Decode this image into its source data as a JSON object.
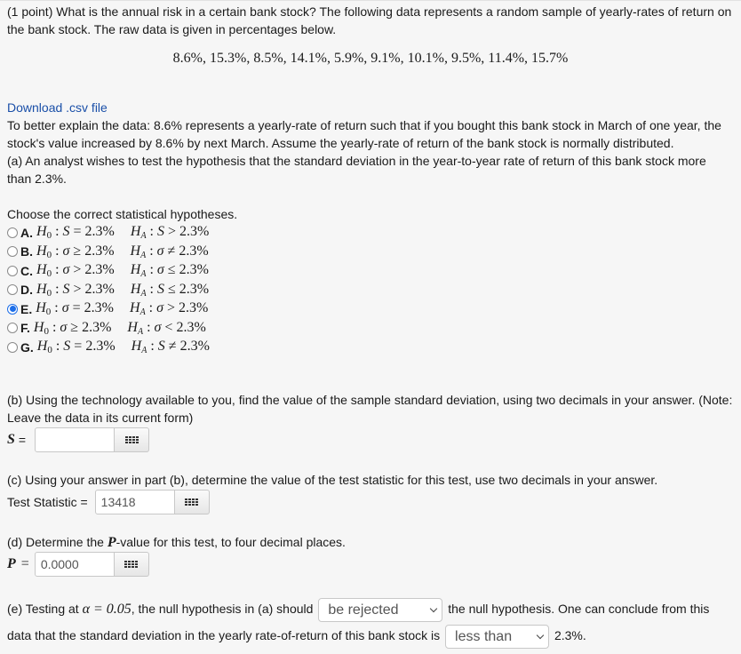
{
  "question": {
    "intro_line1": "(1 point) What is the annual risk in a certain bank stock? The following data represents a random sample of yearly-rates of return on",
    "intro_line2": "the bank stock. The raw data is given in percentages below.",
    "data_values": "8.6%, 15.3%, 8.5%, 14.1%, 5.9%, 9.1%, 10.1%, 9.5%, 11.4%, 15.7%",
    "download_link": "Download .csv file",
    "explain_line1": "To better explain the data: 8.6% represents a yearly-rate of return such that if you bought this bank stock in March of one year, the",
    "explain_line2": "stock's value increased by 8.6% by next March. Assume the yearly-rate of return of the bank stock is normally distributed.",
    "part_a_line1": "(a) An analyst wishes to test the hypothesis that the standard deviation in the year-to-year rate of return of this bank stock more",
    "part_a_line2": "than 2.3%."
  },
  "hypotheses": {
    "prompt": "Choose the correct statistical hypotheses.",
    "selected": "E",
    "options": [
      {
        "letter": "A.",
        "h0": "H₀ : S = 2.3%",
        "ha": "Hₐ : S > 2.3%",
        "checked": false
      },
      {
        "letter": "B.",
        "h0": "H₀ : σ ≥ 2.3%",
        "ha": "Hₐ : σ ≠ 2.3%",
        "checked": false
      },
      {
        "letter": "C.",
        "h0": "H₀ : σ > 2.3%",
        "ha": "Hₐ : σ ≤ 2.3%",
        "checked": false
      },
      {
        "letter": "D.",
        "h0": "H₀ : S > 2.3%",
        "ha": "Hₐ : S ≤ 2.3%",
        "checked": false
      },
      {
        "letter": "E.",
        "h0": "H₀ : σ = 2.3%",
        "ha": "Hₐ : σ > 2.3%",
        "checked": true
      },
      {
        "letter": "F.",
        "h0": "H₀ : σ ≥ 2.3%",
        "ha": "Hₐ : σ < 2.3%",
        "checked": false
      },
      {
        "letter": "G.",
        "h0": "H₀ : S = 2.3%",
        "ha": "Hₐ : S ≠ 2.3%",
        "checked": false
      }
    ]
  },
  "part_b": {
    "line1": "(b) Using the technology available to you, find the value of the sample standard deviation, using two decimals in your answer. (Note:",
    "line2": "Leave the data in its current form)",
    "label": "S =",
    "value": ""
  },
  "part_c": {
    "text": "(c) Using your answer in part (b), determine the value of the test statistic for this test, use two decimals in your answer.",
    "label": "Test Statistic =",
    "value": "13418"
  },
  "part_d": {
    "text_pre": "(d) Determine the ",
    "text_var": "P",
    "text_post": "-value for this test, to four decimal places.",
    "label_var": "P",
    "label_eq": "=",
    "value": "0.0000"
  },
  "part_e": {
    "text1_pre": "(e) Testing at ",
    "alpha": "α = 0.05",
    "text1_mid": ", the null hypothesis in (a) should",
    "select1": "be rejected",
    "text1_post": "the null hypothesis. One can conclude from this",
    "text2_pre": "data that the standard deviation in the yearly rate-of-return of this bank stock is",
    "select2": "less than",
    "text2_post": "2.3%."
  }
}
